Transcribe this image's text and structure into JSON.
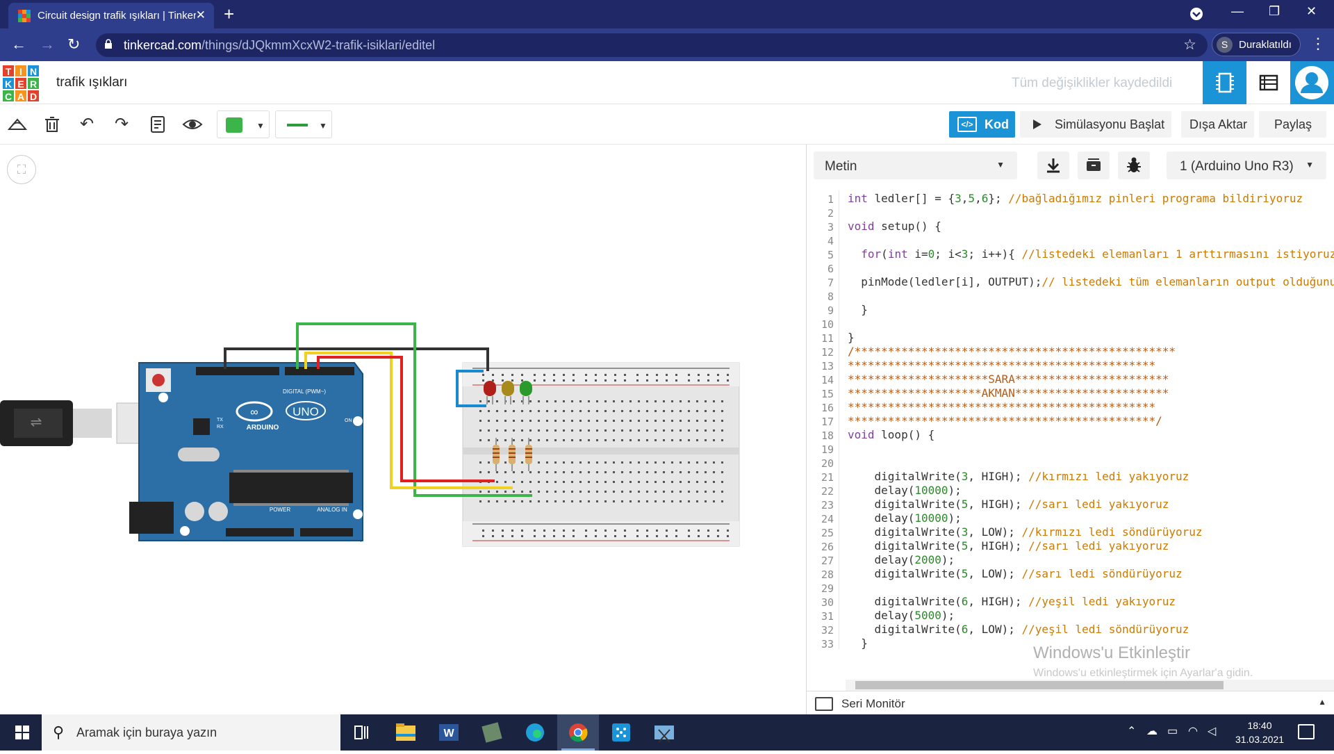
{
  "browser": {
    "tab_title": "Circuit design trafik ışıkları | Tinkercad",
    "url_domain": "tinkercad.com",
    "url_path": "/things/dJQkmmXcxW2-trafik-isiklari/editel",
    "profile_initial": "S",
    "profile_label": "Duraklatıldı"
  },
  "header": {
    "logo_letters": [
      "T",
      "I",
      "N",
      "K",
      "E",
      "R",
      "C",
      "A",
      "D"
    ],
    "logo_colors": [
      "#e2412c",
      "#f7941d",
      "#1a94d6",
      "#1a94d6",
      "#e2412c",
      "#3bb54a",
      "#3bb54a",
      "#f7941d",
      "#e2412c"
    ],
    "project_title": "trafik ışıkları",
    "save_status": "Tüm değişiklikler kaydedildi"
  },
  "toolbar": {
    "code_button": "Kod",
    "start_sim_button": "Simülasyonu Başlat",
    "export_button": "Dışa Aktar",
    "share_button": "Paylaş",
    "wire_color": "#3bb54a"
  },
  "code_panel": {
    "mode_select": "Metin",
    "board_select": "1 (Arduino Uno R3)",
    "serial_monitor": "Seri Monitör",
    "watermark_title": "Windows'u Etkinleştir",
    "watermark_sub": "Windows'u etkinleştirmek için Ayarlar'a gidin.",
    "line_numbers": [
      "1",
      "2",
      "3",
      "4",
      "5",
      "6",
      "7",
      "8",
      "9",
      "10",
      "11",
      "12",
      "13",
      "14",
      "15",
      "16",
      "17",
      "18",
      "19",
      "20",
      "21",
      "22",
      "23",
      "24",
      "25",
      "26",
      "27",
      "28",
      "29",
      "30",
      "31",
      "32",
      "33"
    ],
    "code_lines": [
      "int ledler[] = {3,5,6}; //bağladığımız pinleri programa bildiriyoruz",
      "",
      "void setup() {",
      "",
      "  for(int i=0; i<3; i++){ //listedeki elemanları 1 arttırmasını istiyoruz",
      "",
      "  pinMode(ledler[i], OUTPUT);// listedeki tüm elemanların output olduğunu",
      "",
      "  }",
      "",
      "}",
      "/************************************************",
      "**********************************************",
      "*********************SARA***********************",
      "********************AKMAN***********************",
      "**********************************************",
      "**********************************************/",
      "void loop() {",
      "",
      "",
      "    digitalWrite(3, HIGH); //kırmızı ledi yakıyoruz",
      "    delay(10000);",
      "    digitalWrite(5, HIGH); //sarı ledi yakıyoruz",
      "    delay(10000);",
      "    digitalWrite(3, LOW); //kırmızı ledi söndürüyoruz",
      "    digitalWrite(5, HIGH); //sarı ledi yakıyoruz",
      "    delay(2000);",
      "    digitalWrite(5, LOW); //sarı ledi söndürüyoruz",
      "",
      "    digitalWrite(6, HIGH); //yeşil ledi yakıyoruz",
      "    delay(5000);",
      "    digitalWrite(6, LOW); //yeşil ledi söndürüyoruz",
      "  }"
    ]
  },
  "circuit": {
    "board_label_uno": "UNO",
    "board_label_arduino": "ARDUINO",
    "board_label_digital": "DIGITAL (PWM~)",
    "board_label_power": "POWER",
    "board_label_analog": "ANALOG IN",
    "board_label_on": "ON",
    "board_label_tx": "TX",
    "board_label_rx": "RX",
    "led_colors": [
      "#b0201b",
      "#a88a1a",
      "#2a9a2a"
    ],
    "wire_colors": {
      "black": "#333333",
      "green": "#3bb54a",
      "yellow": "#f0d020",
      "red": "#e02020",
      "blue": "#1a8ad0"
    }
  },
  "taskbar": {
    "search_placeholder": "Aramak için buraya yazın",
    "time": "18:40",
    "date": "31.03.2021"
  }
}
